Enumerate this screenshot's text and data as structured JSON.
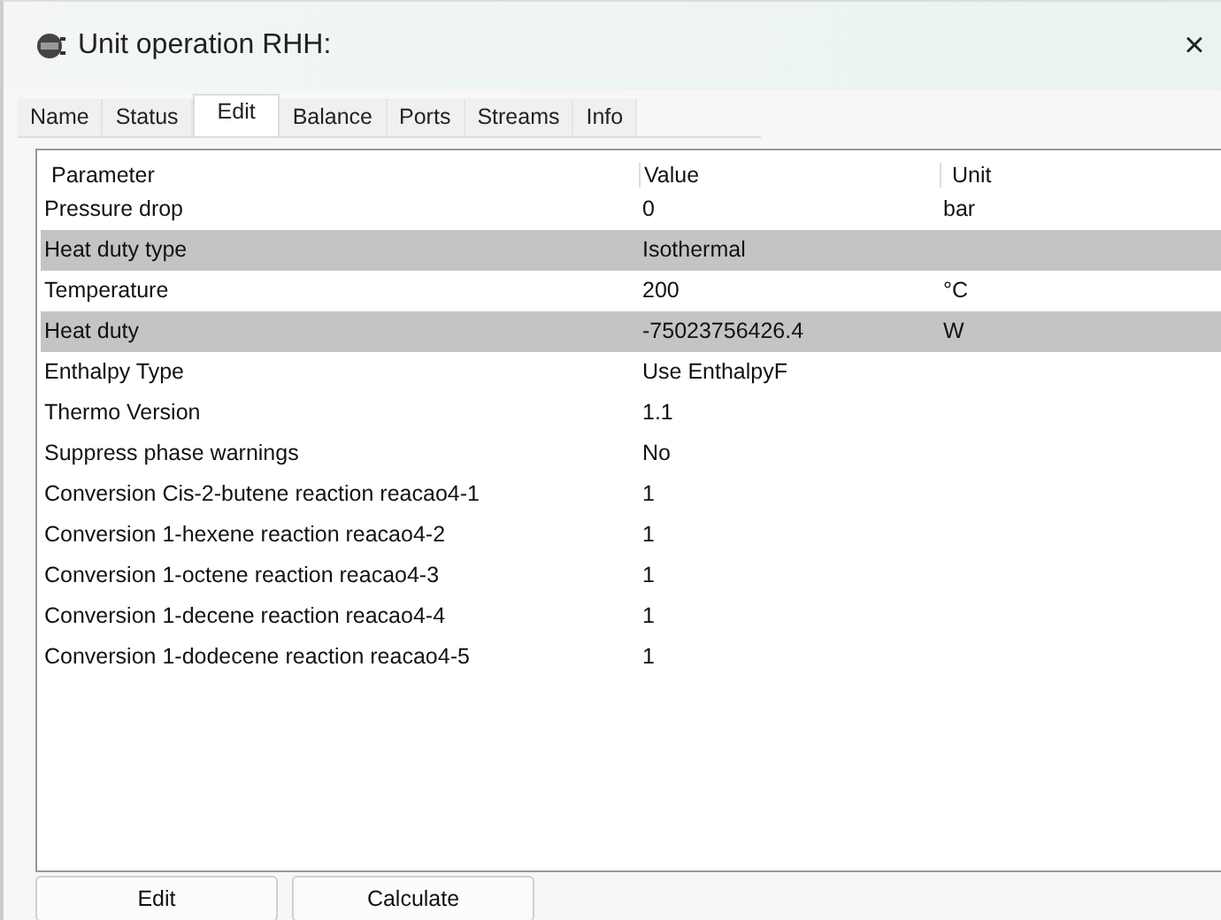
{
  "window": {
    "title": "Unit operation RHH:",
    "close": "×"
  },
  "tabs": [
    {
      "label": "Name",
      "selected": false
    },
    {
      "label": "Status",
      "selected": false
    },
    {
      "label": "Edit",
      "selected": true
    },
    {
      "label": "Balance",
      "selected": false
    },
    {
      "label": "Ports",
      "selected": false
    },
    {
      "label": "Streams",
      "selected": false
    },
    {
      "label": "Info",
      "selected": false
    }
  ],
  "table": {
    "columns": [
      "Parameter",
      "Value",
      "Unit"
    ],
    "rows": [
      {
        "cells": [
          "Pressure drop",
          "0",
          "bar"
        ],
        "selected": false
      },
      {
        "cells": [
          "Heat duty type",
          "Isothermal",
          ""
        ],
        "selected": true
      },
      {
        "cells": [
          "Temperature",
          "200",
          "°C"
        ],
        "selected": false
      },
      {
        "cells": [
          "Heat duty",
          "-75023756426.4",
          "W"
        ],
        "selected": true
      },
      {
        "cells": [
          "Enthalpy Type",
          "Use EnthalpyF",
          ""
        ],
        "selected": false
      },
      {
        "cells": [
          "Thermo Version",
          "1.1",
          ""
        ],
        "selected": false
      },
      {
        "cells": [
          "Suppress phase warnings",
          "No",
          ""
        ],
        "selected": false
      },
      {
        "cells": [
          "Conversion Cis-2-butene reaction reacao4-1",
          "1",
          ""
        ],
        "selected": false
      },
      {
        "cells": [
          "Conversion 1-hexene reaction reacao4-2",
          "1",
          ""
        ],
        "selected": false
      },
      {
        "cells": [
          "Conversion 1-octene reaction reacao4-3",
          "1",
          ""
        ],
        "selected": false
      },
      {
        "cells": [
          "Conversion 1-decene reaction reacao4-4",
          "1",
          ""
        ],
        "selected": false
      },
      {
        "cells": [
          "Conversion 1-dodecene reaction reacao4-5",
          "1",
          ""
        ],
        "selected": false
      }
    ]
  },
  "buttons": [
    "Edit",
    "Calculate"
  ]
}
